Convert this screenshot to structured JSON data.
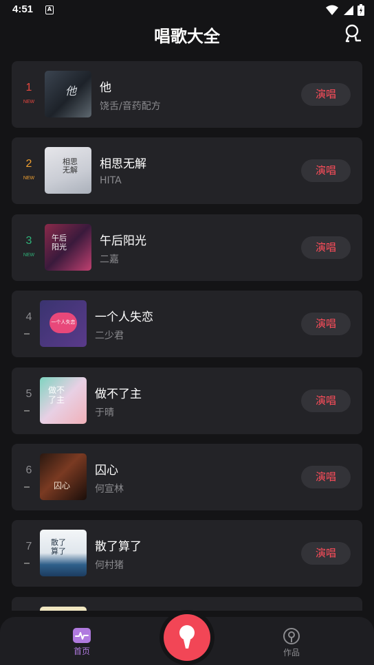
{
  "status_bar": {
    "time": "4:51",
    "notif_letter": "A"
  },
  "header": {
    "title": "唱歌大全"
  },
  "songs": [
    {
      "rank": "1",
      "tag": "NEW",
      "title": "他",
      "artist": "饶舌/音药配方",
      "button": "演唱"
    },
    {
      "rank": "2",
      "tag": "NEW",
      "title": "相思无解",
      "artist": "HITA",
      "button": "演唱"
    },
    {
      "rank": "3",
      "tag": "NEW",
      "title": "午后阳光",
      "artist": "二嘉",
      "button": "演唱"
    },
    {
      "rank": "4",
      "tag": "",
      "title": "一个人失恋",
      "artist": "二少君",
      "button": "演唱"
    },
    {
      "rank": "5",
      "tag": "",
      "title": "做不了主",
      "artist": "于晴",
      "button": "演唱"
    },
    {
      "rank": "6",
      "tag": "",
      "title": "囚心",
      "artist": "何宣林",
      "button": "演唱"
    },
    {
      "rank": "7",
      "tag": "",
      "title": "散了算了",
      "artist": "何村猪",
      "button": "演唱"
    }
  ],
  "covers": [
    {
      "text": "他"
    },
    {
      "text": "相思无解"
    },
    {
      "text": "午后阳光"
    },
    {
      "text": "一个人失恋"
    },
    {
      "text": "做不了主"
    },
    {
      "text": "囚心"
    },
    {
      "text": "散了算了"
    }
  ],
  "tabbar": {
    "home_label": "首页",
    "works_label": "作品"
  },
  "colors": {
    "accent": "#f24656",
    "rank1": "#e8473f",
    "rank2": "#f0a030",
    "rank3": "#2fb37a",
    "muted": "#8b8b8f"
  }
}
